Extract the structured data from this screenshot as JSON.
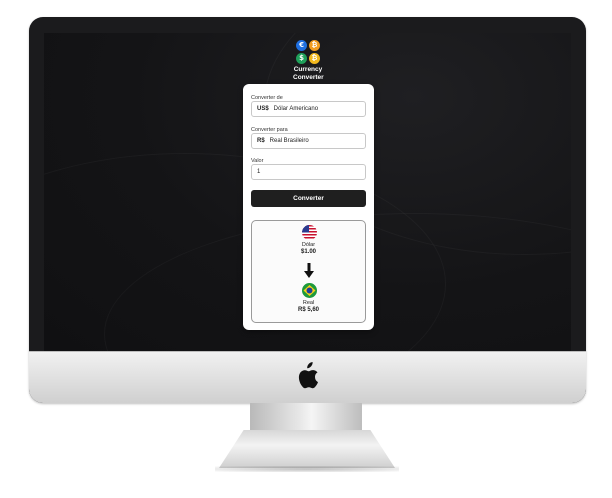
{
  "brand": {
    "line1": "Currency",
    "line2": "Converter",
    "coin_symbols": [
      "€",
      "₿",
      "$",
      "₿"
    ],
    "coin_colors": [
      "#1f6fe0",
      "#f29c1f",
      "#1fa05a",
      "#f2b91f"
    ]
  },
  "form": {
    "from_label": "Converter de",
    "from_symbol": "US$",
    "from_value": "Dólar Americano",
    "to_label": "Converter para",
    "to_symbol": "R$",
    "to_value": "Real Brasileiro",
    "amount_label": "Valor",
    "amount_value": "1",
    "convert_button": "Converter"
  },
  "result": {
    "from_name": "Dólar",
    "from_amount": "$1.00",
    "from_flag_icon": "us-flag-icon",
    "arrow_icon": "arrow-down-icon",
    "to_name": "Real",
    "to_amount": "R$ 5,60",
    "to_flag_icon": "brazil-flag-icon"
  },
  "device": {
    "logo_icon": "apple-logo-icon"
  },
  "colors": {
    "button_bg": "#1f1f1f",
    "screen_bg": "#141416"
  }
}
